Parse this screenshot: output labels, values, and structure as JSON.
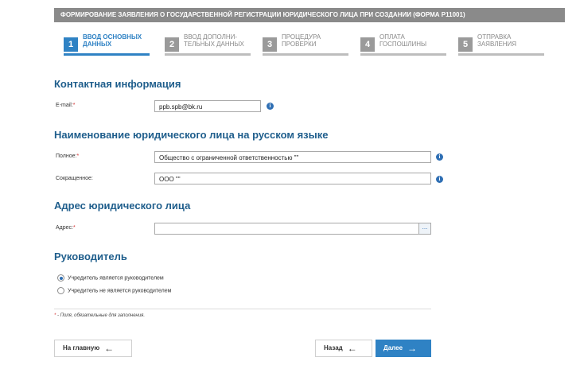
{
  "header": {
    "title": "ФОРМИРОВАНИЕ ЗАЯВЛЕНИЯ О ГОСУДАРСТВЕННОЙ РЕГИСТРАЦИИ ЮРИДИЧЕСКОГО ЛИЦА ПРИ СОЗДАНИИ (ФОРМА Р11001)"
  },
  "steps": [
    {
      "num": "1",
      "line1": "ВВОД ОСНОВНЫХ",
      "line2": "ДАННЫХ",
      "active": true
    },
    {
      "num": "2",
      "line1": "ВВОД ДОПОЛНИ-",
      "line2": "ТЕЛЬНЫХ ДАННЫХ",
      "active": false
    },
    {
      "num": "3",
      "line1": "ПРОЦЕДУРА",
      "line2": "ПРОВЕРКИ",
      "active": false
    },
    {
      "num": "4",
      "line1": "ОПЛАТА",
      "line2": "ГОСПОШЛИНЫ",
      "active": false
    },
    {
      "num": "5",
      "line1": "ОТПРАВКА",
      "line2": "ЗАЯВЛЕНИЯ",
      "active": false
    }
  ],
  "contact": {
    "title": "Контактная информация",
    "email_label": "E-mail:",
    "email_value": "ppb.spb@bk.ru"
  },
  "name_section": {
    "title": "Наименование юридического лица на русском языке",
    "full_label": "Полное:",
    "full_value": "Общество с ограниченной ответственностью \"\"",
    "short_label": "Сокращенное:",
    "short_value": "ООО \"\""
  },
  "address": {
    "title": "Адрес юридического лица",
    "label": "Адрес:",
    "value": "",
    "picker_label": "..."
  },
  "manager": {
    "title": "Руководитель",
    "options": [
      {
        "label": "Учредитель является руководителем",
        "checked": true
      },
      {
        "label": "Учредитель не является руководителем",
        "checked": false
      }
    ]
  },
  "required_marker": "*",
  "note": " - Поля, обязательные для заполнения.",
  "buttons": {
    "home": "На главную",
    "back": "Назад",
    "next": "Далее"
  },
  "icons": {
    "info": "i",
    "arrow_left": "←",
    "arrow_right": "→"
  },
  "colors": {
    "accent": "#2f82c4",
    "section_title": "#1f5e8c",
    "required": "#d32f2f",
    "header_bg": "#8a8a8a"
  }
}
